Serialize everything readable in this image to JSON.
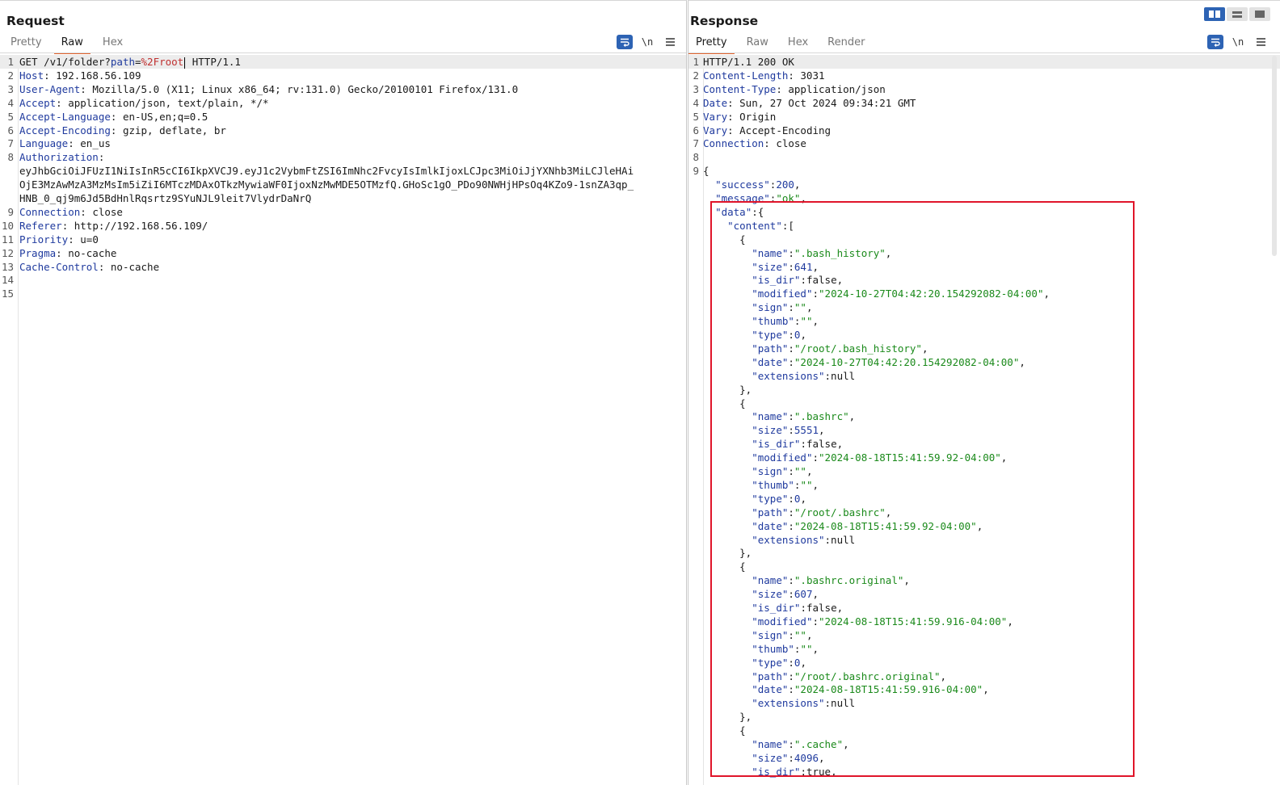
{
  "request": {
    "title": "Request",
    "tabs": [
      "Pretty",
      "Raw",
      "Hex"
    ],
    "active_tab": "Raw",
    "toolbar": {
      "wrap_icon": "wrap-lines-icon",
      "newline_label": "\\n",
      "menu_icon": "hamburger-menu-icon"
    },
    "lines": [
      {
        "n": "1",
        "parts": [
          {
            "t": "GET /v1/folder?"
          },
          {
            "t": "path",
            "c": "k"
          },
          {
            "t": "="
          },
          {
            "t": "%2Froot",
            "c": "p"
          },
          {
            "cursor": true
          },
          {
            "t": " HTTP/1.1"
          }
        ]
      },
      {
        "n": "2",
        "parts": [
          {
            "t": "Host",
            "c": "k"
          },
          {
            "t": ": 192.168.56.109"
          }
        ]
      },
      {
        "n": "3",
        "parts": [
          {
            "t": "User-Agent",
            "c": "k"
          },
          {
            "t": ": Mozilla/5.0 (X11; Linux x86_64; rv:131.0) Gecko/20100101 Firefox/131.0"
          }
        ]
      },
      {
        "n": "4",
        "parts": [
          {
            "t": "Accept",
            "c": "k"
          },
          {
            "t": ": application/json, text/plain, */*"
          }
        ]
      },
      {
        "n": "5",
        "parts": [
          {
            "t": "Accept-Language",
            "c": "k"
          },
          {
            "t": ": en-US,en;q=0.5"
          }
        ]
      },
      {
        "n": "6",
        "parts": [
          {
            "t": "Accept-Encoding",
            "c": "k"
          },
          {
            "t": ": gzip, deflate, br"
          }
        ]
      },
      {
        "n": "7",
        "parts": [
          {
            "t": "Language",
            "c": "k"
          },
          {
            "t": ": en_us"
          }
        ]
      },
      {
        "n": "8",
        "parts": [
          {
            "t": "Authorization",
            "c": "k"
          },
          {
            "t": ":"
          }
        ]
      },
      {
        "n": "",
        "parts": [
          {
            "t": "eyJhbGciOiJFUzI1NiIsInR5cCI6IkpXVCJ9.eyJ1c2VybmFtZSI6ImNhc2FvcyIsImlkIjoxLCJpc3MiOiJjYXNhb3MiLCJleHAi"
          }
        ]
      },
      {
        "n": "",
        "parts": [
          {
            "t": "OjE3MzAwMzA3MzMsIm5iZiI6MTczMDAxOTkzMywiaWF0IjoxNzMwMDE5OTMzfQ.GHoSc1gO_PDo90NWHjHPsOq4KZo9-1snZA3qp_"
          }
        ]
      },
      {
        "n": "",
        "parts": [
          {
            "t": "HNB_0_qj9m6Jd5BdHnlRqsrtz9SYuNJL9leit7VlydrDaNrQ"
          }
        ]
      },
      {
        "n": "9",
        "parts": [
          {
            "t": "Connection",
            "c": "k"
          },
          {
            "t": ": close"
          }
        ]
      },
      {
        "n": "10",
        "parts": [
          {
            "t": "Referer",
            "c": "k"
          },
          {
            "t": ": http://192.168.56.109/"
          }
        ]
      },
      {
        "n": "11",
        "parts": [
          {
            "t": "Priority",
            "c": "k"
          },
          {
            "t": ": u=0"
          }
        ]
      },
      {
        "n": "12",
        "parts": [
          {
            "t": "Pragma",
            "c": "k"
          },
          {
            "t": ": no-cache"
          }
        ]
      },
      {
        "n": "13",
        "parts": [
          {
            "t": "Cache-Control",
            "c": "k"
          },
          {
            "t": ": no-cache"
          }
        ]
      },
      {
        "n": "14",
        "parts": []
      },
      {
        "n": "15",
        "parts": []
      }
    ]
  },
  "response": {
    "title": "Response",
    "tabs": [
      "Pretty",
      "Raw",
      "Hex",
      "Render"
    ],
    "active_tab": "Pretty",
    "toolbar": {
      "wrap_icon": "wrap-lines-icon",
      "newline_label": "\\n",
      "menu_icon": "hamburger-menu-icon"
    },
    "lines": [
      {
        "n": "1",
        "parts": [
          {
            "t": "HTTP/1.1 200 OK"
          }
        ]
      },
      {
        "n": "2",
        "parts": [
          {
            "t": "Content-Length",
            "c": "k"
          },
          {
            "t": ": 3031"
          }
        ]
      },
      {
        "n": "3",
        "parts": [
          {
            "t": "Content-Type",
            "c": "k"
          },
          {
            "t": ": application/json"
          }
        ]
      },
      {
        "n": "4",
        "parts": [
          {
            "t": "Date",
            "c": "k"
          },
          {
            "t": ": Sun, 27 Oct 2024 09:34:21 GMT"
          }
        ]
      },
      {
        "n": "5",
        "parts": [
          {
            "t": "Vary",
            "c": "k"
          },
          {
            "t": ": Origin"
          }
        ]
      },
      {
        "n": "6",
        "parts": [
          {
            "t": "Vary",
            "c": "k"
          },
          {
            "t": ": Accept-Encoding"
          }
        ]
      },
      {
        "n": "7",
        "parts": [
          {
            "t": "Connection",
            "c": "k"
          },
          {
            "t": ": close"
          }
        ]
      },
      {
        "n": "8",
        "parts": []
      },
      {
        "n": "9",
        "parts": [
          {
            "t": "{"
          }
        ]
      },
      {
        "n": "",
        "parts": [
          {
            "t": "  "
          },
          {
            "t": "\"success\"",
            "c": "k"
          },
          {
            "t": ":"
          },
          {
            "t": "200",
            "c": "n"
          },
          {
            "t": ","
          }
        ]
      },
      {
        "n": "",
        "parts": [
          {
            "t": "  "
          },
          {
            "t": "\"message\"",
            "c": "k"
          },
          {
            "t": ":"
          },
          {
            "t": "\"ok\"",
            "c": "s"
          },
          {
            "t": ","
          }
        ]
      },
      {
        "n": "",
        "parts": [
          {
            "t": "  "
          },
          {
            "t": "\"data\"",
            "c": "k"
          },
          {
            "t": ":{"
          }
        ]
      },
      {
        "n": "",
        "parts": [
          {
            "t": "    "
          },
          {
            "t": "\"content\"",
            "c": "k"
          },
          {
            "t": ":["
          }
        ]
      },
      {
        "n": "",
        "parts": [
          {
            "t": "      {"
          }
        ]
      },
      {
        "n": "",
        "parts": [
          {
            "t": "        "
          },
          {
            "t": "\"name\"",
            "c": "k"
          },
          {
            "t": ":"
          },
          {
            "t": "\".bash_history\"",
            "c": "s"
          },
          {
            "t": ","
          }
        ]
      },
      {
        "n": "",
        "parts": [
          {
            "t": "        "
          },
          {
            "t": "\"size\"",
            "c": "k"
          },
          {
            "t": ":"
          },
          {
            "t": "641",
            "c": "n"
          },
          {
            "t": ","
          }
        ]
      },
      {
        "n": "",
        "parts": [
          {
            "t": "        "
          },
          {
            "t": "\"is_dir\"",
            "c": "k"
          },
          {
            "t": ":false,"
          }
        ]
      },
      {
        "n": "",
        "parts": [
          {
            "t": "        "
          },
          {
            "t": "\"modified\"",
            "c": "k"
          },
          {
            "t": ":"
          },
          {
            "t": "\"2024-10-27T04:42:20.154292082-04:00\"",
            "c": "s"
          },
          {
            "t": ","
          }
        ]
      },
      {
        "n": "",
        "parts": [
          {
            "t": "        "
          },
          {
            "t": "\"sign\"",
            "c": "k"
          },
          {
            "t": ":"
          },
          {
            "t": "\"\"",
            "c": "s"
          },
          {
            "t": ","
          }
        ]
      },
      {
        "n": "",
        "parts": [
          {
            "t": "        "
          },
          {
            "t": "\"thumb\"",
            "c": "k"
          },
          {
            "t": ":"
          },
          {
            "t": "\"\"",
            "c": "s"
          },
          {
            "t": ","
          }
        ]
      },
      {
        "n": "",
        "parts": [
          {
            "t": "        "
          },
          {
            "t": "\"type\"",
            "c": "k"
          },
          {
            "t": ":"
          },
          {
            "t": "0",
            "c": "n"
          },
          {
            "t": ","
          }
        ]
      },
      {
        "n": "",
        "parts": [
          {
            "t": "        "
          },
          {
            "t": "\"path\"",
            "c": "k"
          },
          {
            "t": ":"
          },
          {
            "t": "\"/root/.bash_history\"",
            "c": "s"
          },
          {
            "t": ","
          }
        ]
      },
      {
        "n": "",
        "parts": [
          {
            "t": "        "
          },
          {
            "t": "\"date\"",
            "c": "k"
          },
          {
            "t": ":"
          },
          {
            "t": "\"2024-10-27T04:42:20.154292082-04:00\"",
            "c": "s"
          },
          {
            "t": ","
          }
        ]
      },
      {
        "n": "",
        "parts": [
          {
            "t": "        "
          },
          {
            "t": "\"extensions\"",
            "c": "k"
          },
          {
            "t": ":null"
          }
        ]
      },
      {
        "n": "",
        "parts": [
          {
            "t": "      },"
          }
        ]
      },
      {
        "n": "",
        "parts": [
          {
            "t": "      {"
          }
        ]
      },
      {
        "n": "",
        "parts": [
          {
            "t": "        "
          },
          {
            "t": "\"name\"",
            "c": "k"
          },
          {
            "t": ":"
          },
          {
            "t": "\".bashrc\"",
            "c": "s"
          },
          {
            "t": ","
          }
        ]
      },
      {
        "n": "",
        "parts": [
          {
            "t": "        "
          },
          {
            "t": "\"size\"",
            "c": "k"
          },
          {
            "t": ":"
          },
          {
            "t": "5551",
            "c": "n"
          },
          {
            "t": ","
          }
        ]
      },
      {
        "n": "",
        "parts": [
          {
            "t": "        "
          },
          {
            "t": "\"is_dir\"",
            "c": "k"
          },
          {
            "t": ":false,"
          }
        ]
      },
      {
        "n": "",
        "parts": [
          {
            "t": "        "
          },
          {
            "t": "\"modified\"",
            "c": "k"
          },
          {
            "t": ":"
          },
          {
            "t": "\"2024-08-18T15:41:59.92-04:00\"",
            "c": "s"
          },
          {
            "t": ","
          }
        ]
      },
      {
        "n": "",
        "parts": [
          {
            "t": "        "
          },
          {
            "t": "\"sign\"",
            "c": "k"
          },
          {
            "t": ":"
          },
          {
            "t": "\"\"",
            "c": "s"
          },
          {
            "t": ","
          }
        ]
      },
      {
        "n": "",
        "parts": [
          {
            "t": "        "
          },
          {
            "t": "\"thumb\"",
            "c": "k"
          },
          {
            "t": ":"
          },
          {
            "t": "\"\"",
            "c": "s"
          },
          {
            "t": ","
          }
        ]
      },
      {
        "n": "",
        "parts": [
          {
            "t": "        "
          },
          {
            "t": "\"type\"",
            "c": "k"
          },
          {
            "t": ":"
          },
          {
            "t": "0",
            "c": "n"
          },
          {
            "t": ","
          }
        ]
      },
      {
        "n": "",
        "parts": [
          {
            "t": "        "
          },
          {
            "t": "\"path\"",
            "c": "k"
          },
          {
            "t": ":"
          },
          {
            "t": "\"/root/.bashrc\"",
            "c": "s"
          },
          {
            "t": ","
          }
        ]
      },
      {
        "n": "",
        "parts": [
          {
            "t": "        "
          },
          {
            "t": "\"date\"",
            "c": "k"
          },
          {
            "t": ":"
          },
          {
            "t": "\"2024-08-18T15:41:59.92-04:00\"",
            "c": "s"
          },
          {
            "t": ","
          }
        ]
      },
      {
        "n": "",
        "parts": [
          {
            "t": "        "
          },
          {
            "t": "\"extensions\"",
            "c": "k"
          },
          {
            "t": ":null"
          }
        ]
      },
      {
        "n": "",
        "parts": [
          {
            "t": "      },"
          }
        ]
      },
      {
        "n": "",
        "parts": [
          {
            "t": "      {"
          }
        ]
      },
      {
        "n": "",
        "parts": [
          {
            "t": "        "
          },
          {
            "t": "\"name\"",
            "c": "k"
          },
          {
            "t": ":"
          },
          {
            "t": "\".bashrc.original\"",
            "c": "s"
          },
          {
            "t": ","
          }
        ]
      },
      {
        "n": "",
        "parts": [
          {
            "t": "        "
          },
          {
            "t": "\"size\"",
            "c": "k"
          },
          {
            "t": ":"
          },
          {
            "t": "607",
            "c": "n"
          },
          {
            "t": ","
          }
        ]
      },
      {
        "n": "",
        "parts": [
          {
            "t": "        "
          },
          {
            "t": "\"is_dir\"",
            "c": "k"
          },
          {
            "t": ":false,"
          }
        ]
      },
      {
        "n": "",
        "parts": [
          {
            "t": "        "
          },
          {
            "t": "\"modified\"",
            "c": "k"
          },
          {
            "t": ":"
          },
          {
            "t": "\"2024-08-18T15:41:59.916-04:00\"",
            "c": "s"
          },
          {
            "t": ","
          }
        ]
      },
      {
        "n": "",
        "parts": [
          {
            "t": "        "
          },
          {
            "t": "\"sign\"",
            "c": "k"
          },
          {
            "t": ":"
          },
          {
            "t": "\"\"",
            "c": "s"
          },
          {
            "t": ","
          }
        ]
      },
      {
        "n": "",
        "parts": [
          {
            "t": "        "
          },
          {
            "t": "\"thumb\"",
            "c": "k"
          },
          {
            "t": ":"
          },
          {
            "t": "\"\"",
            "c": "s"
          },
          {
            "t": ","
          }
        ]
      },
      {
        "n": "",
        "parts": [
          {
            "t": "        "
          },
          {
            "t": "\"type\"",
            "c": "k"
          },
          {
            "t": ":"
          },
          {
            "t": "0",
            "c": "n"
          },
          {
            "t": ","
          }
        ]
      },
      {
        "n": "",
        "parts": [
          {
            "t": "        "
          },
          {
            "t": "\"path\"",
            "c": "k"
          },
          {
            "t": ":"
          },
          {
            "t": "\"/root/.bashrc.original\"",
            "c": "s"
          },
          {
            "t": ","
          }
        ]
      },
      {
        "n": "",
        "parts": [
          {
            "t": "        "
          },
          {
            "t": "\"date\"",
            "c": "k"
          },
          {
            "t": ":"
          },
          {
            "t": "\"2024-08-18T15:41:59.916-04:00\"",
            "c": "s"
          },
          {
            "t": ","
          }
        ]
      },
      {
        "n": "",
        "parts": [
          {
            "t": "        "
          },
          {
            "t": "\"extensions\"",
            "c": "k"
          },
          {
            "t": ":null"
          }
        ]
      },
      {
        "n": "",
        "parts": [
          {
            "t": "      },"
          }
        ]
      },
      {
        "n": "",
        "parts": [
          {
            "t": "      {"
          }
        ]
      },
      {
        "n": "",
        "parts": [
          {
            "t": "        "
          },
          {
            "t": "\"name\"",
            "c": "k"
          },
          {
            "t": ":"
          },
          {
            "t": "\".cache\"",
            "c": "s"
          },
          {
            "t": ","
          }
        ]
      },
      {
        "n": "",
        "parts": [
          {
            "t": "        "
          },
          {
            "t": "\"size\"",
            "c": "k"
          },
          {
            "t": ":"
          },
          {
            "t": "4096",
            "c": "n"
          },
          {
            "t": ","
          }
        ]
      },
      {
        "n": "",
        "parts": [
          {
            "t": "        "
          },
          {
            "t": "\"is_dir\"",
            "c": "k"
          },
          {
            "t": ":true,"
          }
        ]
      }
    ]
  },
  "layout_switch": {
    "options": [
      "side-by-side-icon",
      "stacked-icon",
      "single-pane-icon"
    ],
    "active": 0
  },
  "colors": {
    "accent": "#e3622b",
    "highlight_box": "#e0152a",
    "header_key": "#1f3a9e",
    "string": "#1b8a1b"
  }
}
